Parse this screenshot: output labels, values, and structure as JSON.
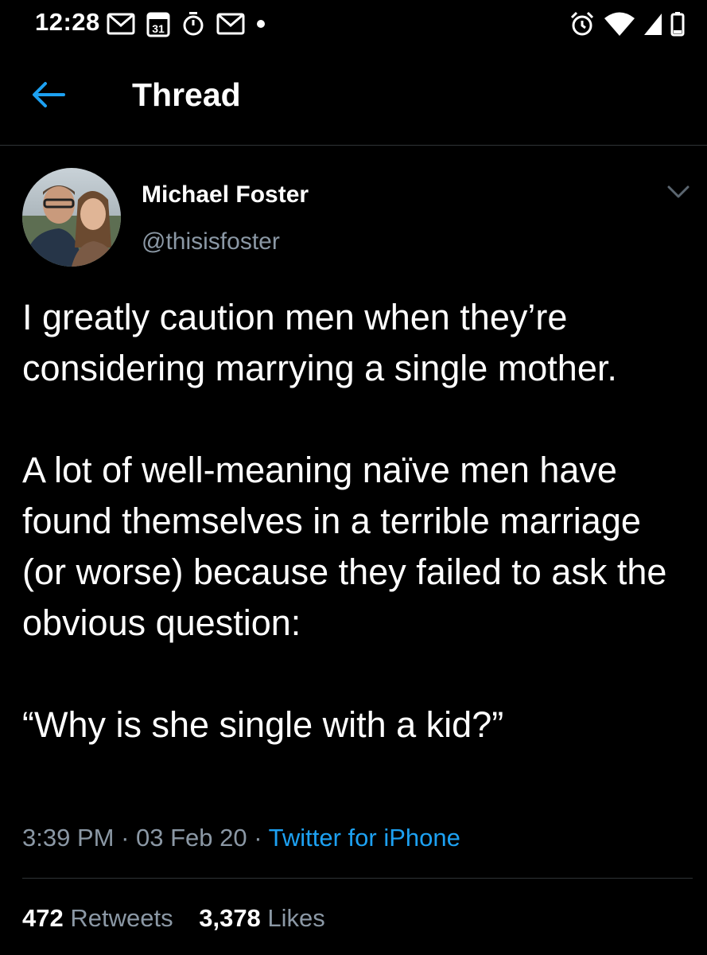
{
  "status_bar": {
    "time": "12:28",
    "calendar_day": "31",
    "left_icons": [
      "gmail-icon",
      "calendar-icon",
      "timer-icon",
      "gmail-icon",
      "notification-dot-icon"
    ],
    "right_icons": [
      "alarm-icon",
      "wifi-icon",
      "cellular-signal-icon",
      "battery-icon"
    ]
  },
  "header": {
    "title": "Thread",
    "back_icon": "back-arrow-icon",
    "accent_color": "#1da1f2"
  },
  "tweet": {
    "author": {
      "name": "Michael Foster",
      "handle": "@thisisfoster"
    },
    "paragraphs": [
      "I greatly caution men when they’re considering marrying a single mother.",
      "A lot of well-meaning naïve men have found themselves in a terrible marriage (or worse) because they failed to ask the obvious question:",
      "“Why is she single with a kid?”"
    ],
    "meta": {
      "time": "3:39 PM",
      "separator": " · ",
      "date": "03 Feb 20",
      "source": "Twitter for iPhone"
    },
    "stats": {
      "retweets_count": "472",
      "retweets_label": "Retweets",
      "likes_count": "3,378",
      "likes_label": "Likes"
    }
  },
  "colors": {
    "background": "#000000",
    "text": "#ffffff",
    "secondary_text": "#8b98a5",
    "link": "#1da1f2",
    "divider": "#2f3336"
  }
}
